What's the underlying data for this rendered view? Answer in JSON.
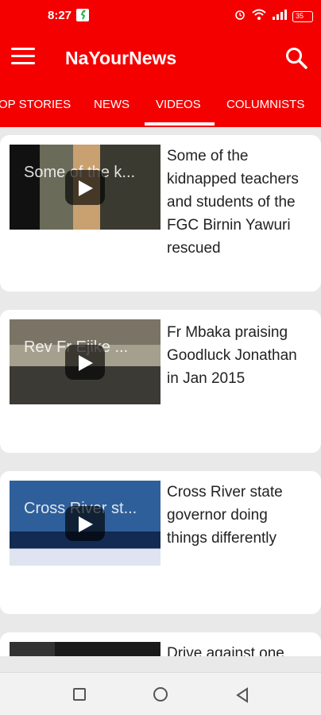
{
  "status_bar": {
    "time": "8:27",
    "battery": "35"
  },
  "app": {
    "title": "NaYourNews"
  },
  "tabs": [
    {
      "label": "OP STORIES"
    },
    {
      "label": "NEWS"
    },
    {
      "label": "VIDEOS",
      "active": true
    },
    {
      "label": "COLUMNISTS"
    }
  ],
  "videos": [
    {
      "thumb_overlay": "Some of the k...",
      "title": "Some of the kidnapped teachers and students of the FGC Birnin Yawuri rescued"
    },
    {
      "thumb_overlay": "Rev Fr Ejike ...",
      "title": "Fr Mbaka praising Goodluck Jonathan in Jan 2015"
    },
    {
      "thumb_overlay": "Cross River st...",
      "title": "Cross River state governor doing things differently"
    },
    {
      "thumb_overlay": "",
      "title": "Drive against one"
    }
  ],
  "colors": {
    "brand_red": "#f40000",
    "background": "#e9e9e9"
  }
}
